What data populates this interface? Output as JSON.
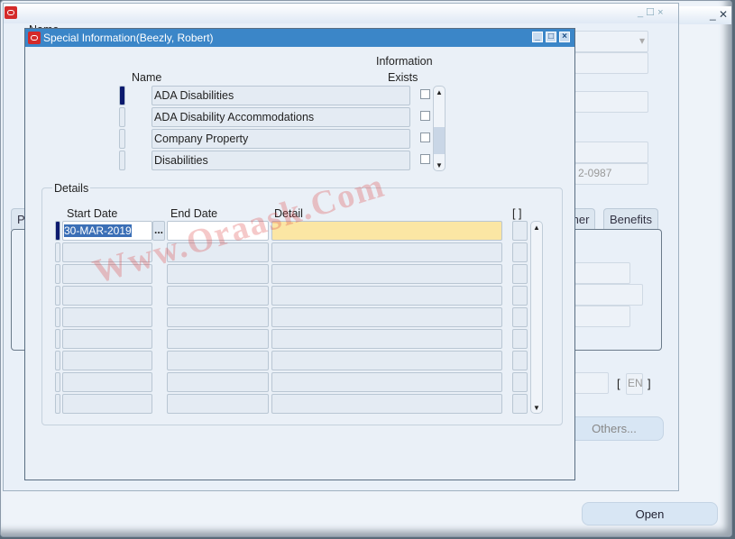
{
  "background": {
    "name_label": "Name",
    "phone_fragment": "2-0987",
    "tabs": [
      "P",
      "ther",
      "Benefits"
    ],
    "lang_field": "EN",
    "others_button": "Others...",
    "open_button": "Open"
  },
  "dialog": {
    "title": "Special Information(Beezly, Robert)",
    "name_header": "Name",
    "info_header_1": "Information",
    "info_header_2": "Exists",
    "items": [
      {
        "label": "ADA Disabilities",
        "exists": false
      },
      {
        "label": "ADA Disability Accommodations",
        "exists": false
      },
      {
        "label": "Company Property",
        "exists": false
      },
      {
        "label": "Disabilities",
        "exists": false
      }
    ],
    "details": {
      "group_label": "Details",
      "columns": [
        "Start Date",
        "End Date",
        "Detail",
        "[ ]"
      ],
      "rows": [
        {
          "start": "30-MAR-2019",
          "end": "",
          "detail": ""
        },
        {
          "start": "",
          "end": "",
          "detail": ""
        },
        {
          "start": "",
          "end": "",
          "detail": ""
        },
        {
          "start": "",
          "end": "",
          "detail": ""
        },
        {
          "start": "",
          "end": "",
          "detail": ""
        },
        {
          "start": "",
          "end": "",
          "detail": ""
        },
        {
          "start": "",
          "end": "",
          "detail": ""
        },
        {
          "start": "",
          "end": "",
          "detail": ""
        },
        {
          "start": "",
          "end": "",
          "detail": ""
        }
      ],
      "lov_button": "..."
    }
  },
  "watermark": "Www.Oraask.Com",
  "colors": {
    "titlebar": "#3b86c8",
    "current_field": "#fbe6a4",
    "record_indicator": "#0c1a6e"
  }
}
